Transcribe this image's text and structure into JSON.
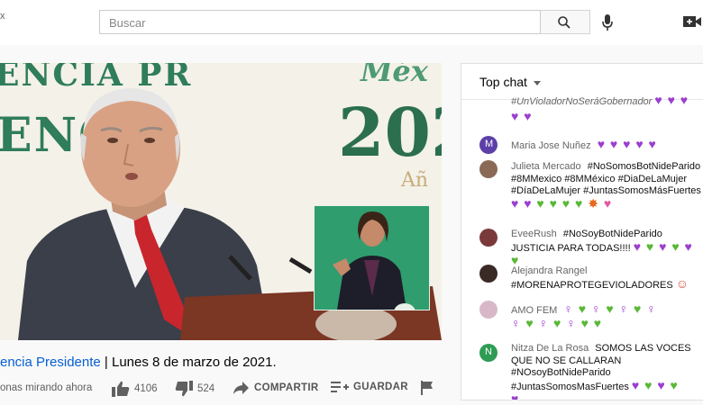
{
  "header": {
    "logo_fragment": "x",
    "search_placeholder": "Buscar",
    "icons": [
      "search-icon",
      "mic-icon",
      "create-video-icon"
    ]
  },
  "video": {
    "title_tag": "#ConferenciaPresidente",
    "title_tag_visible": "encia Presidente",
    "title_rest": " | Lunes 8 de marzo de 2021.",
    "viewers": "onas mirando ahora",
    "likes": "4106",
    "dislikes": "524",
    "share_label": "COMPARTIR",
    "save_label": "GUARDAR",
    "bg_text_1": "ENCIA PR",
    "bg_text_2": "ENCI",
    "bg_text_3": "202",
    "bg_text_4": "Méx",
    "bg_text_5": "Añ"
  },
  "chat": {
    "header": "Top chat",
    "messages": [
      {
        "author": "",
        "text": "#UnVioladorNoSeráGobernador"
      },
      {
        "author": "Maria Jose Nuñez",
        "text": ""
      },
      {
        "author": "Julieta Mercado",
        "text": "#NoSomosBotNideParido #8MMexico #8MMéxico #DiaDeLaMujer #DíaDeLaMujer #JuntasSomosMásFuertes"
      },
      {
        "author": "EveeRush",
        "text": "#NoSoyBotNideParido JUSTICIA PARA TODAS!!!!"
      },
      {
        "author": "Alejandra Rangel",
        "text": "#MORENAPROTEGEVIOLADORES"
      },
      {
        "author": "AMO FEM",
        "text": ""
      },
      {
        "author": "Nitza De La Rosa",
        "text": "SOMOS LAS VOCES QUE NO SE CALLARAN #NOsoyBotNideParido #JuntasSomosMasFuertes"
      }
    ],
    "avatar_letters": {
      "maria": "M",
      "nitza": "N"
    },
    "colors": {
      "purple_heart": "#9b3fcf",
      "green_heart": "#58b836"
    }
  }
}
